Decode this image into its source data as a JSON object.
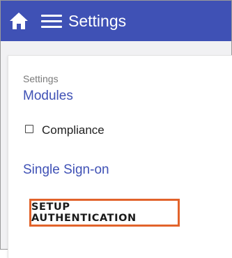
{
  "header": {
    "title": "Settings",
    "background_color": "#3f51b5",
    "home_icon": "home-icon",
    "menu_icon": "hamburger-menu-icon"
  },
  "content": {
    "breadcrumb": "Settings",
    "modules_link": "Modules",
    "compliance": {
      "label": "Compliance",
      "checked": false
    },
    "sso_link": "Single Sign-on",
    "setup_button": {
      "label": "SETUP AUTHENTICATION",
      "highlight_color": "#e2632b"
    },
    "link_color": "#3f51b5"
  }
}
